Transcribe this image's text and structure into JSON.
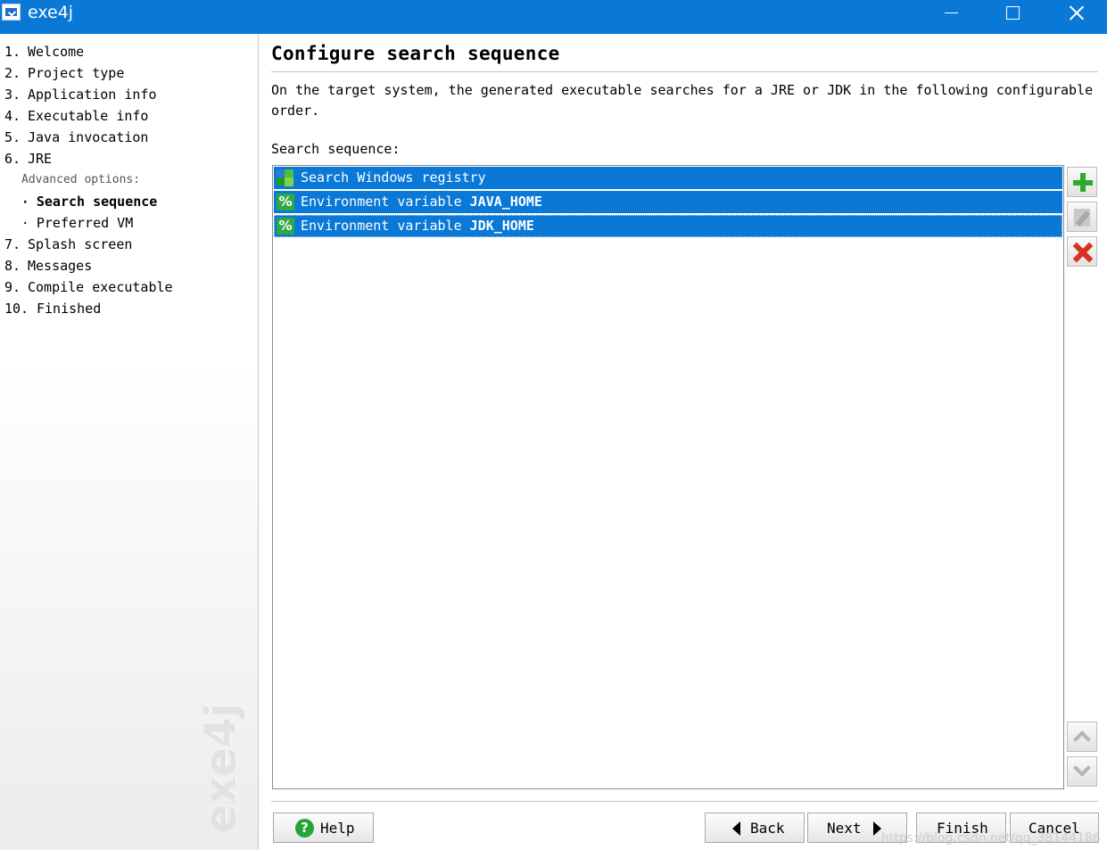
{
  "window": {
    "title": "exe4j"
  },
  "nav": {
    "items": [
      {
        "num": "1.",
        "label": "Welcome"
      },
      {
        "num": "2.",
        "label": "Project type"
      },
      {
        "num": "3.",
        "label": "Application info"
      },
      {
        "num": "4.",
        "label": "Executable info"
      },
      {
        "num": "5.",
        "label": "Java invocation"
      },
      {
        "num": "6.",
        "label": "JRE"
      }
    ],
    "advanced_label": "Advanced options:",
    "sub_items": [
      {
        "label": "Search sequence",
        "active": true
      },
      {
        "label": "Preferred VM",
        "active": false
      }
    ],
    "items_after": [
      {
        "num": "7.",
        "label": "Splash screen"
      },
      {
        "num": "8.",
        "label": "Messages"
      },
      {
        "num": "9.",
        "label": "Compile executable"
      },
      {
        "num": "10.",
        "label": "Finished"
      }
    ],
    "watermark": "exe4j"
  },
  "main": {
    "title": "Configure search sequence",
    "description": "On the target system, the generated executable searches for a JRE or JDK in the following configurable order.",
    "sequence_label": "Search sequence:",
    "sequence": [
      {
        "prefix": "Search Windows registry",
        "bold": "",
        "icon": "registry-icon"
      },
      {
        "prefix": "Environment variable ",
        "bold": "JAVA_HOME",
        "icon": "percent-icon"
      },
      {
        "prefix": "Environment variable ",
        "bold": "JDK_HOME",
        "icon": "percent-icon"
      }
    ],
    "icon_glyphs": {
      "percent": "%"
    }
  },
  "buttons": {
    "help": "Help",
    "back": "Back",
    "next": "Next",
    "finish": "Finish",
    "cancel": "Cancel",
    "help_glyph": "?"
  },
  "footer": {
    "url_watermark": "https://blog.csdn.net/qq_38144186"
  },
  "colors": {
    "titlebar": "#0a78d7",
    "selection": "#0a78d7",
    "add": "#2bab2b",
    "delete": "#d9321e"
  }
}
